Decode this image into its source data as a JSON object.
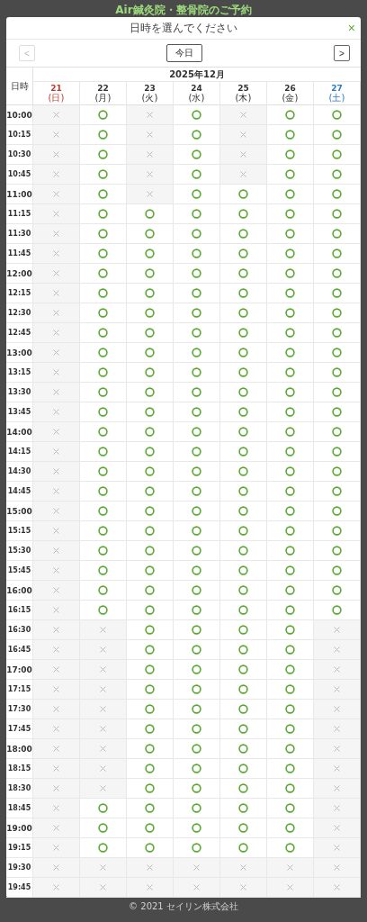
{
  "page_title": "Air鍼灸院・整骨院のご予約",
  "dialog": {
    "title": "日時を選んでください",
    "close": "×"
  },
  "nav": {
    "prev": {
      "label": "<",
      "disabled": true
    },
    "today": "今日",
    "next": {
      "label": ">",
      "disabled": false
    }
  },
  "calendar": {
    "corner": "日時",
    "month": "2025年12月",
    "days": [
      {
        "date": "21",
        "weekday": "(日)",
        "color": "#c0392b"
      },
      {
        "date": "22",
        "weekday": "(月)",
        "color": "#333333"
      },
      {
        "date": "23",
        "weekday": "(火)",
        "color": "#333333"
      },
      {
        "date": "24",
        "weekday": "(水)",
        "color": "#333333"
      },
      {
        "date": "25",
        "weekday": "(木)",
        "color": "#333333"
      },
      {
        "date": "26",
        "weekday": "(金)",
        "color": "#333333"
      },
      {
        "date": "27",
        "weekday": "(土)",
        "color": "#2b7bc4"
      }
    ],
    "rows": [
      {
        "time": "10:00",
        "hour": true,
        "available": [
          false,
          true,
          false,
          true,
          false,
          true,
          true
        ]
      },
      {
        "time": "10:15",
        "hour": false,
        "available": [
          false,
          true,
          false,
          true,
          false,
          true,
          true
        ]
      },
      {
        "time": "10:30",
        "hour": false,
        "available": [
          false,
          true,
          false,
          true,
          false,
          true,
          true
        ]
      },
      {
        "time": "10:45",
        "hour": false,
        "available": [
          false,
          true,
          false,
          true,
          false,
          true,
          true
        ]
      },
      {
        "time": "11:00",
        "hour": true,
        "available": [
          false,
          true,
          false,
          true,
          true,
          true,
          true
        ]
      },
      {
        "time": "11:15",
        "hour": false,
        "available": [
          false,
          true,
          true,
          true,
          true,
          true,
          true
        ]
      },
      {
        "time": "11:30",
        "hour": false,
        "available": [
          false,
          true,
          true,
          true,
          true,
          true,
          true
        ]
      },
      {
        "time": "11:45",
        "hour": false,
        "available": [
          false,
          true,
          true,
          true,
          true,
          true,
          true
        ]
      },
      {
        "time": "12:00",
        "hour": true,
        "available": [
          false,
          true,
          true,
          true,
          true,
          true,
          true
        ]
      },
      {
        "time": "12:15",
        "hour": false,
        "available": [
          false,
          true,
          true,
          true,
          true,
          true,
          true
        ]
      },
      {
        "time": "12:30",
        "hour": false,
        "available": [
          false,
          true,
          true,
          true,
          true,
          true,
          true
        ]
      },
      {
        "time": "12:45",
        "hour": false,
        "available": [
          false,
          true,
          true,
          true,
          true,
          true,
          true
        ]
      },
      {
        "time": "13:00",
        "hour": true,
        "available": [
          false,
          true,
          true,
          true,
          true,
          true,
          true
        ]
      },
      {
        "time": "13:15",
        "hour": false,
        "available": [
          false,
          true,
          true,
          true,
          true,
          true,
          true
        ]
      },
      {
        "time": "13:30",
        "hour": false,
        "available": [
          false,
          true,
          true,
          true,
          true,
          true,
          true
        ]
      },
      {
        "time": "13:45",
        "hour": false,
        "available": [
          false,
          true,
          true,
          true,
          true,
          true,
          true
        ]
      },
      {
        "time": "14:00",
        "hour": true,
        "available": [
          false,
          true,
          true,
          true,
          true,
          true,
          true
        ]
      },
      {
        "time": "14:15",
        "hour": false,
        "available": [
          false,
          true,
          true,
          true,
          true,
          true,
          true
        ]
      },
      {
        "time": "14:30",
        "hour": false,
        "available": [
          false,
          true,
          true,
          true,
          true,
          true,
          true
        ]
      },
      {
        "time": "14:45",
        "hour": false,
        "available": [
          false,
          true,
          true,
          true,
          true,
          true,
          true
        ]
      },
      {
        "time": "15:00",
        "hour": true,
        "available": [
          false,
          true,
          true,
          true,
          true,
          true,
          true
        ]
      },
      {
        "time": "15:15",
        "hour": false,
        "available": [
          false,
          true,
          true,
          true,
          true,
          true,
          true
        ]
      },
      {
        "time": "15:30",
        "hour": false,
        "available": [
          false,
          true,
          true,
          true,
          true,
          true,
          true
        ]
      },
      {
        "time": "15:45",
        "hour": false,
        "available": [
          false,
          true,
          true,
          true,
          true,
          true,
          true
        ]
      },
      {
        "time": "16:00",
        "hour": true,
        "available": [
          false,
          true,
          true,
          true,
          true,
          true,
          true
        ]
      },
      {
        "time": "16:15",
        "hour": false,
        "available": [
          false,
          true,
          true,
          true,
          true,
          true,
          true
        ]
      },
      {
        "time": "16:30",
        "hour": false,
        "available": [
          false,
          false,
          true,
          true,
          true,
          true,
          false
        ]
      },
      {
        "time": "16:45",
        "hour": false,
        "available": [
          false,
          false,
          true,
          true,
          true,
          true,
          false
        ]
      },
      {
        "time": "17:00",
        "hour": true,
        "available": [
          false,
          false,
          true,
          true,
          true,
          true,
          false
        ]
      },
      {
        "time": "17:15",
        "hour": false,
        "available": [
          false,
          false,
          true,
          true,
          true,
          true,
          false
        ]
      },
      {
        "time": "17:30",
        "hour": false,
        "available": [
          false,
          false,
          true,
          true,
          true,
          true,
          false
        ]
      },
      {
        "time": "17:45",
        "hour": false,
        "available": [
          false,
          false,
          true,
          true,
          true,
          true,
          false
        ]
      },
      {
        "time": "18:00",
        "hour": true,
        "available": [
          false,
          false,
          true,
          true,
          true,
          true,
          false
        ]
      },
      {
        "time": "18:15",
        "hour": false,
        "available": [
          false,
          false,
          true,
          true,
          true,
          true,
          false
        ]
      },
      {
        "time": "18:30",
        "hour": false,
        "available": [
          false,
          false,
          true,
          true,
          true,
          true,
          false
        ]
      },
      {
        "time": "18:45",
        "hour": false,
        "available": [
          false,
          true,
          true,
          true,
          true,
          true,
          false
        ]
      },
      {
        "time": "19:00",
        "hour": true,
        "available": [
          false,
          true,
          true,
          true,
          true,
          true,
          false
        ]
      },
      {
        "time": "19:15",
        "hour": false,
        "available": [
          false,
          true,
          true,
          true,
          true,
          true,
          false
        ]
      },
      {
        "time": "19:30",
        "hour": false,
        "available": [
          false,
          false,
          false,
          false,
          false,
          false,
          false
        ]
      },
      {
        "time": "19:45",
        "hour": false,
        "available": [
          false,
          false,
          false,
          false,
          false,
          false,
          false
        ]
      }
    ]
  },
  "footer": "© 2021 セイリン株式会社"
}
